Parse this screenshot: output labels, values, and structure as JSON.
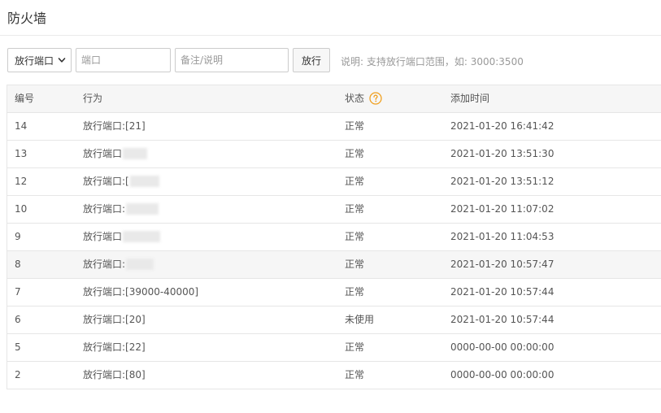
{
  "page": {
    "title": "防火墙"
  },
  "toolbar": {
    "select_value": "放行端口",
    "port_placeholder": "端口",
    "note_placeholder": "备注/说明",
    "allow_label": "放行",
    "hint": "说明: 支持放行端口范围，如: 3000:3500"
  },
  "colors": {
    "help_icon": "#f0a020",
    "header_bg": "#f6f6f6",
    "border": "#e6e6e6"
  },
  "icons": {
    "select": "chevron-down-icon",
    "status_help": "question-circle-icon"
  },
  "table": {
    "headers": {
      "id": "编号",
      "action": "行为",
      "status": "状态",
      "time": "添加时间"
    },
    "rows": [
      {
        "id": "14",
        "action": "放行端口:[21]",
        "status": "正常",
        "time": "2021-01-20 16:41:42"
      },
      {
        "id": "13",
        "action": "放行端口",
        "status": "正常",
        "time": "2021-01-20 13:51:30"
      },
      {
        "id": "12",
        "action": "放行端口:[",
        "status": "正常",
        "time": "2021-01-20 13:51:12"
      },
      {
        "id": "10",
        "action": "放行端口:",
        "status": "正常",
        "time": "2021-01-20 11:07:02"
      },
      {
        "id": "9",
        "action": "放行端口",
        "status": "正常",
        "time": "2021-01-20 11:04:53"
      },
      {
        "id": "8",
        "action": "放行端口:",
        "status": "正常",
        "time": "2021-01-20 10:57:47"
      },
      {
        "id": "7",
        "action": "放行端口:[39000-40000]",
        "status": "正常",
        "time": "2021-01-20 10:57:44"
      },
      {
        "id": "6",
        "action": "放行端口:[20]",
        "status": "未使用",
        "time": "2021-01-20 10:57:44"
      },
      {
        "id": "5",
        "action": "放行端口:[22]",
        "status": "正常",
        "time": "0000-00-00 00:00:00"
      },
      {
        "id": "2",
        "action": "放行端口:[80]",
        "status": "正常",
        "time": "0000-00-00 00:00:00"
      }
    ]
  }
}
